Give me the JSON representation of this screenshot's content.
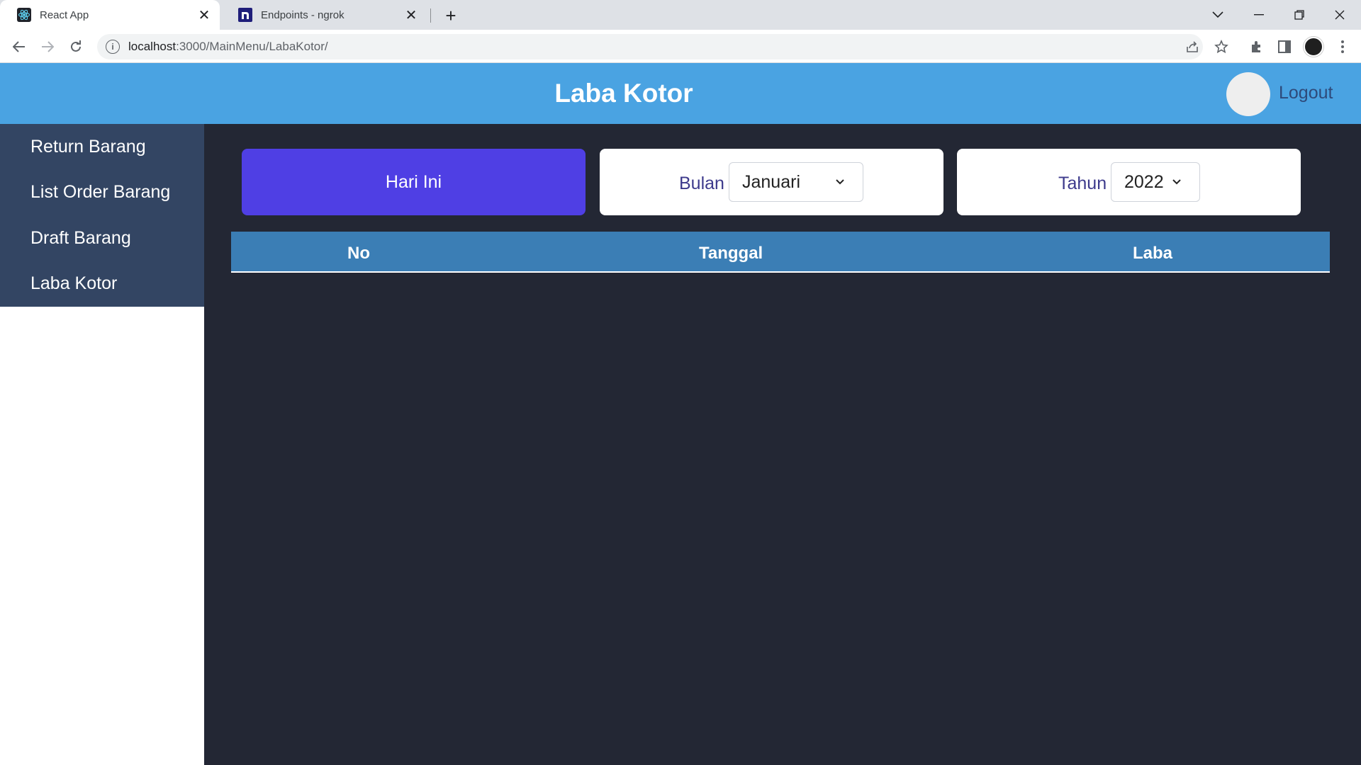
{
  "browser": {
    "tabs": [
      {
        "title": "React App",
        "icon": "react-icon",
        "active": true
      },
      {
        "title": "Endpoints - ngrok",
        "icon": "ngrok-icon",
        "active": false
      }
    ],
    "url_host": "localhost",
    "url_rest": ":3000/MainMenu/LabaKotor/"
  },
  "header": {
    "title": "Laba Kotor",
    "logout_label": "Logout"
  },
  "sidebar": {
    "items": [
      {
        "label": "Return Barang"
      },
      {
        "label": "List Order Barang"
      },
      {
        "label": "Draft Barang"
      },
      {
        "label": "Laba Kotor"
      }
    ]
  },
  "filters": {
    "today_label": "Hari Ini",
    "month_label": "Bulan",
    "month_value": "Januari",
    "year_label": "Tahun",
    "year_value": "2022"
  },
  "table": {
    "columns": [
      "No",
      "Tanggal",
      "Laba"
    ],
    "rows": []
  },
  "colors": {
    "appbar": "#4aa3e2",
    "sidebar": "#334563",
    "content_bg": "#232734",
    "today_button": "#4f3fe4",
    "table_header": "#3b7eb5"
  }
}
